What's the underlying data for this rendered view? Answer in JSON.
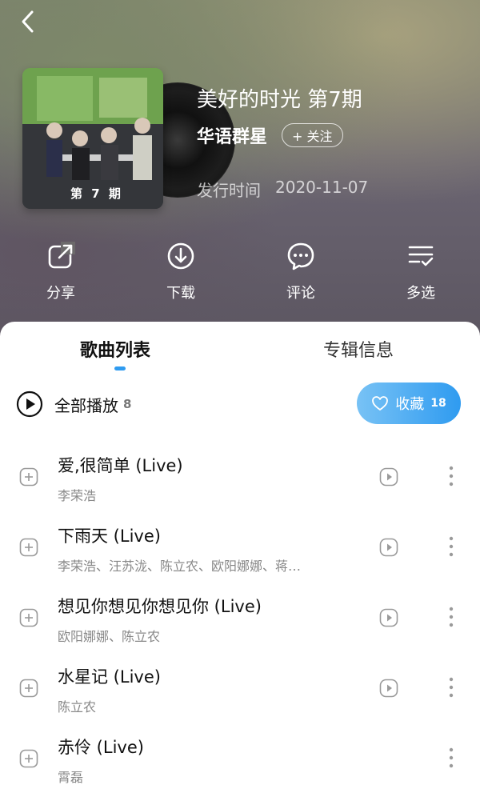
{
  "album": {
    "title": "美好的时光 第7期",
    "artist": "华语群星",
    "follow_label": "+ 关注",
    "release_label": "发行时间",
    "release_date": "2020-11-07",
    "cover_text": "第 7 期"
  },
  "actions": {
    "share": "分享",
    "download": "下载",
    "comment": "评论",
    "multi_select": "多选"
  },
  "tabs": {
    "songs": "歌曲列表",
    "album_info": "专辑信息"
  },
  "play_all": {
    "label": "全部播放",
    "count": "8"
  },
  "favorite": {
    "label": "收藏",
    "count": "18"
  },
  "songs": [
    {
      "title": "爱,很简单 (Live)",
      "artist": "李荣浩"
    },
    {
      "title": "下雨天 (Live)",
      "artist": "李荣浩、汪苏泷、陈立农、欧阳娜娜、蒋…"
    },
    {
      "title": "想见你想见你想见你 (Live)",
      "artist": "欧阳娜娜、陈立农"
    },
    {
      "title": "水星记 (Live)",
      "artist": "陈立农"
    },
    {
      "title": "赤伶 (Live)",
      "artist": "霄磊"
    }
  ],
  "colors": {
    "accent": "#2f9bf0",
    "accent_light": "#78c2f5"
  }
}
